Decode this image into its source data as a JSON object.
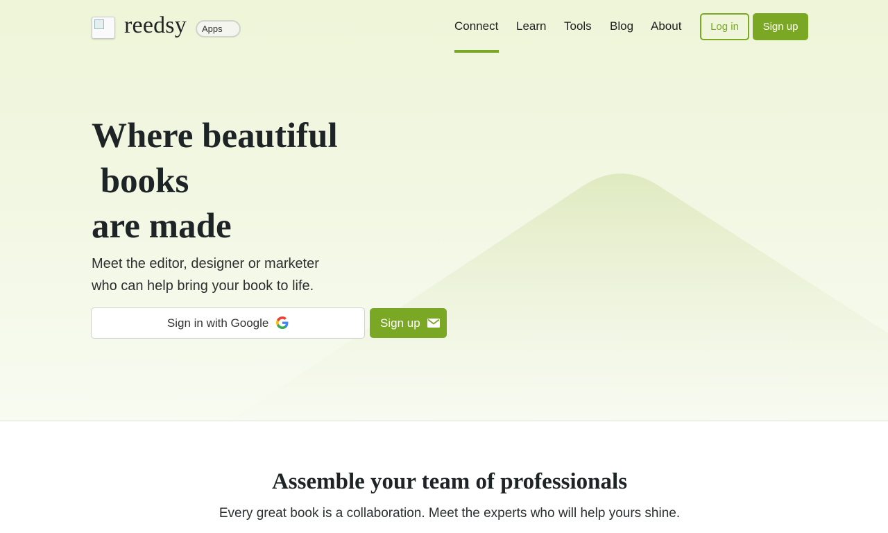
{
  "header": {
    "logo_text": "reedsy",
    "apps_badge": "Apps",
    "nav": [
      "Connect",
      "Learn",
      "Tools",
      "Blog",
      "About"
    ],
    "active_nav": "Connect",
    "login_label": "Log in",
    "signup_label": "Sign up"
  },
  "hero": {
    "title_lines": [
      "Where beautiful",
      " books",
      "are made"
    ],
    "subtitle_lines": [
      "Meet the editor, designer or marketer",
      "who can help bring your book to life."
    ],
    "google_button": "Sign in with Google",
    "signup_button": "Sign up"
  },
  "section": {
    "title": "Assemble your team of professionals",
    "subtitle": "Every great book is a collaboration. Meet the experts who will help yours shine."
  },
  "colors": {
    "accent": "#7aa824",
    "hero_bg": "#eef5d8",
    "text": "#1e2426"
  }
}
